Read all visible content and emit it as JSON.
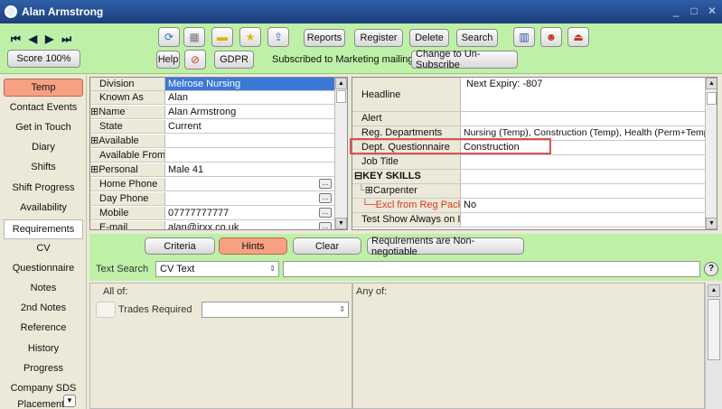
{
  "window": {
    "title": "Alan Armstrong",
    "minimize": "_",
    "maximize": "□",
    "close": "✕"
  },
  "toolbar": {
    "nav": [
      "⏮",
      "◀",
      "▶",
      "⏭"
    ],
    "score": "Score 100%",
    "reports": "Reports",
    "register": "Register",
    "delete": "Delete",
    "search": "Search",
    "help": "Help",
    "gdpr": "GDPR",
    "subscribed_text": "Subscribed to Marketing mailings",
    "unsubscribe": "Change to Un-Subscribe"
  },
  "sidebar": {
    "items": [
      "Temp",
      "Contact Events",
      "Get in Touch",
      "Diary",
      "Shifts",
      "Shift Progress",
      "Availability",
      "Requirements",
      "CV",
      "Questionnaire",
      "Notes",
      "2nd Notes",
      "Reference",
      "History",
      "Progress",
      "Company SDS",
      "Placements"
    ]
  },
  "left_grid": {
    "rows": [
      {
        "label": "Division",
        "value": "Melrose Nursing",
        "expand": "",
        "ellipsis": ""
      },
      {
        "label": "Known As",
        "value": "Alan",
        "expand": "",
        "ellipsis": ""
      },
      {
        "label": "Name",
        "value": "Alan Armstrong",
        "expand": "⊞",
        "ellipsis": ""
      },
      {
        "label": "State",
        "value": "Current",
        "expand": "",
        "ellipsis": ""
      },
      {
        "label": "Available",
        "value": "",
        "expand": "⊞",
        "ellipsis": ""
      },
      {
        "label": "Available From",
        "value": "",
        "expand": "",
        "ellipsis": ""
      },
      {
        "label": "Personal",
        "value": "Male 41",
        "expand": "⊞",
        "ellipsis": ""
      },
      {
        "label": "Home Phone",
        "value": "",
        "expand": "",
        "ellipsis": "..."
      },
      {
        "label": "Day Phone",
        "value": "",
        "expand": "",
        "ellipsis": "..."
      },
      {
        "label": "Mobile",
        "value": "07777777777",
        "expand": "",
        "ellipsis": "..."
      },
      {
        "label": "E-mail",
        "value": "alan@jrxx.co.uk",
        "expand": "",
        "ellipsis": "..."
      }
    ]
  },
  "right_grid": {
    "headline_label": "Headline",
    "headline_value": "Next Expiry: -807",
    "rows": [
      {
        "label": "Alert",
        "value": ""
      },
      {
        "label": "Reg. Departments",
        "value": "Nursing (Temp), Construction (Temp), Health (Perm+Temp)"
      },
      {
        "label": "Dept. Questionnaire",
        "value": "Construction"
      },
      {
        "label": "Job Title",
        "value": ""
      },
      {
        "label": "KEY SKILLS",
        "value": ""
      },
      {
        "label": "Carpenter",
        "value": ""
      },
      {
        "label": "Excl from Reg Pack s",
        "value": "No"
      },
      {
        "label": "Test Show Always on I",
        "value": ""
      }
    ]
  },
  "hints": {
    "criteria": "Criteria",
    "hints": "Hints",
    "clear": "Clear",
    "nonneg": "Requirements are Non-negotiable"
  },
  "search": {
    "label": "Text Search",
    "select_value": "CV Text",
    "query": "",
    "help": "?"
  },
  "all_of": {
    "title": "All of:",
    "trades_label": "Trades Required",
    "trades_value": ""
  },
  "any_of": {
    "title": "Any of:"
  },
  "colors": {
    "toolbar_green": "#bff0a8",
    "active_tab": "#f7a184",
    "selection_blue": "#3b78d8",
    "highlight_red": "#d9534f"
  }
}
